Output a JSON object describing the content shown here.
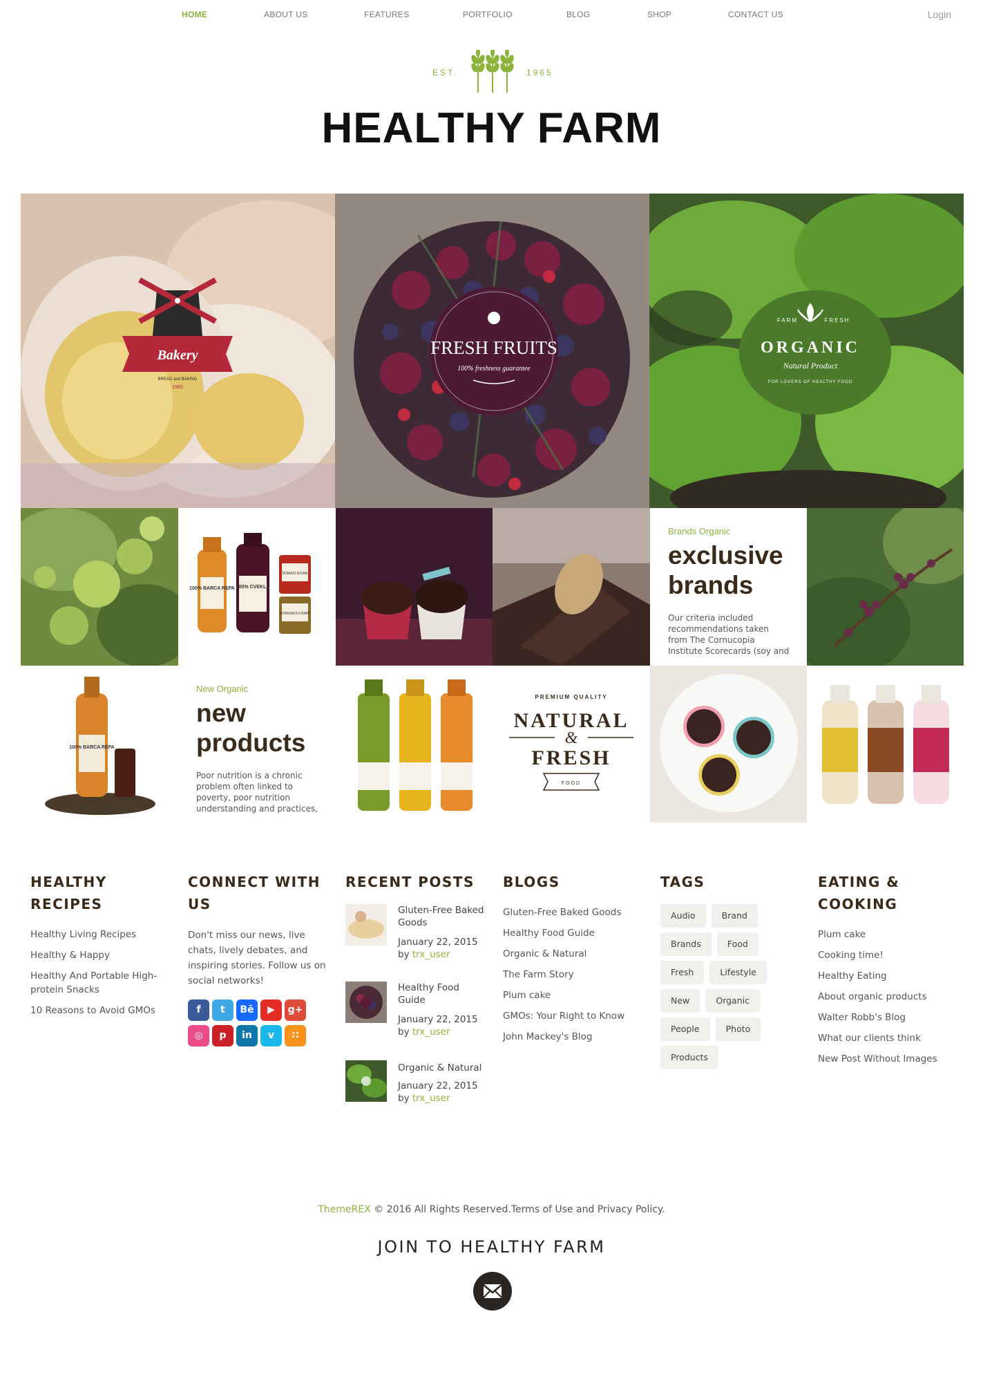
{
  "nav": {
    "items": [
      "HOME",
      "ABOUT US",
      "FEATURES",
      "PORTFOLIO",
      "BLOG",
      "SHOP",
      "CONTACT US"
    ],
    "active": "HOME",
    "login": "Login"
  },
  "logo": {
    "est_left": "EST.",
    "est_right": "1965",
    "title": "HEALTHY FARM"
  },
  "mosaic": {
    "bakery": {
      "label": "Bakery",
      "small": "BREAD and BAKING",
      "year": "1965"
    },
    "fresh_fruits": {
      "title": "FRESH FRUITS",
      "subtitle": "100% freshness guarantee"
    },
    "organic": {
      "farm": "FARM",
      "fresh": "FRESH",
      "title": "ORGANIC",
      "subtitle": "Natural Product",
      "tagline": "FOR LOVERS OF HEALTHY FOOD"
    },
    "jars_labels": [
      "100% BARCA REPA",
      "100% CVEKLA",
      "DOMACI AJVAR",
      "MORNSKOVI BABY"
    ],
    "exclusive_brands": {
      "kicker": "Brands Organic",
      "heading": "exclusive brands",
      "text": "Our criteria included recommendations taken from The Cornucopia Institute Scorecards (soy and"
    },
    "new_products": {
      "kicker": "New Organic",
      "heading": "new products",
      "text": "Poor nutrition is a chronic problem often linked to poverty, poor nutrition understanding and practices,"
    },
    "bottle_label": "100% BARCA REPA",
    "natural_fresh": {
      "top": "PREMIUM QUALITY",
      "line1": "NATURAL",
      "amp": "&",
      "line2": "FRESH",
      "ribbon": "FOOD"
    }
  },
  "widgets": {
    "recipes": {
      "title": "HEALTHY RECIPES",
      "items": [
        "Healthy Living Recipes",
        "Healthy & Happy",
        "Healthy And Portable High-protein Snacks",
        "10 Reasons to Avoid GMOs"
      ]
    },
    "connect": {
      "title": "CONNECT WITH US",
      "text": "Don't miss our news, live chats, lively debates, and inspiring stories. Follow us on social networks!",
      "icons": [
        {
          "name": "facebook-icon",
          "glyph": "f",
          "color": "#3b5a9a"
        },
        {
          "name": "twitter-icon",
          "glyph": "t",
          "color": "#3fa9e8"
        },
        {
          "name": "behance-icon",
          "glyph": "Bē",
          "color": "#1769ff"
        },
        {
          "name": "youtube-icon",
          "glyph": "▶",
          "color": "#e52d27"
        },
        {
          "name": "google-plus-icon",
          "glyph": "g+",
          "color": "#dd4b39"
        },
        {
          "name": "dribbble-icon",
          "glyph": "◎",
          "color": "#ea4c89"
        },
        {
          "name": "pinterest-icon",
          "glyph": "p",
          "color": "#cb2027"
        },
        {
          "name": "linkedin-icon",
          "glyph": "in",
          "color": "#0e76a8"
        },
        {
          "name": "vimeo-icon",
          "glyph": "v",
          "color": "#1ab7ea"
        },
        {
          "name": "rss-icon",
          "glyph": "∷",
          "color": "#f7921e"
        }
      ]
    },
    "recent_posts": {
      "title": "RECENT POSTS",
      "by": "by",
      "posts": [
        {
          "title": "Gluten-Free Baked Goods",
          "date": "January 22, 2015",
          "author": "trx_user"
        },
        {
          "title": "Healthy Food Guide",
          "date": "January 22, 2015",
          "author": "trx_user"
        },
        {
          "title": "Organic & Natural",
          "date": "January 22, 2015",
          "author": "trx_user"
        }
      ]
    },
    "blogs": {
      "title": "BLOGS",
      "items": [
        "Gluten-Free Baked Goods",
        "Healthy Food Guide",
        "Organic & Natural",
        "The Farm Story",
        "Plum cake",
        "GMOs: Your Right to Know",
        "John Mackey's Blog"
      ]
    },
    "tags": {
      "title": "TAGS",
      "items": [
        "Audio",
        "Brand",
        "Brands",
        "Food",
        "Fresh",
        "Lifestyle",
        "New",
        "Organic",
        "People",
        "Photo",
        "Products"
      ]
    },
    "eating": {
      "title": "EATING & COOKING",
      "items": [
        "Plum cake",
        "Cooking time!",
        "Healthy Eating",
        "About organic products",
        "Walter Robb's Blog",
        "What our clients think",
        "New Post Without Images"
      ]
    }
  },
  "footer": {
    "brand": "ThemeREX",
    "copyright": " © 2016 All Rights Reserved.Terms of Use and Privacy Policy.",
    "join": "JOIN TO HEALTHY FARM"
  },
  "colors": {
    "accent": "#8cb33a",
    "heading": "#3a2a1a"
  }
}
